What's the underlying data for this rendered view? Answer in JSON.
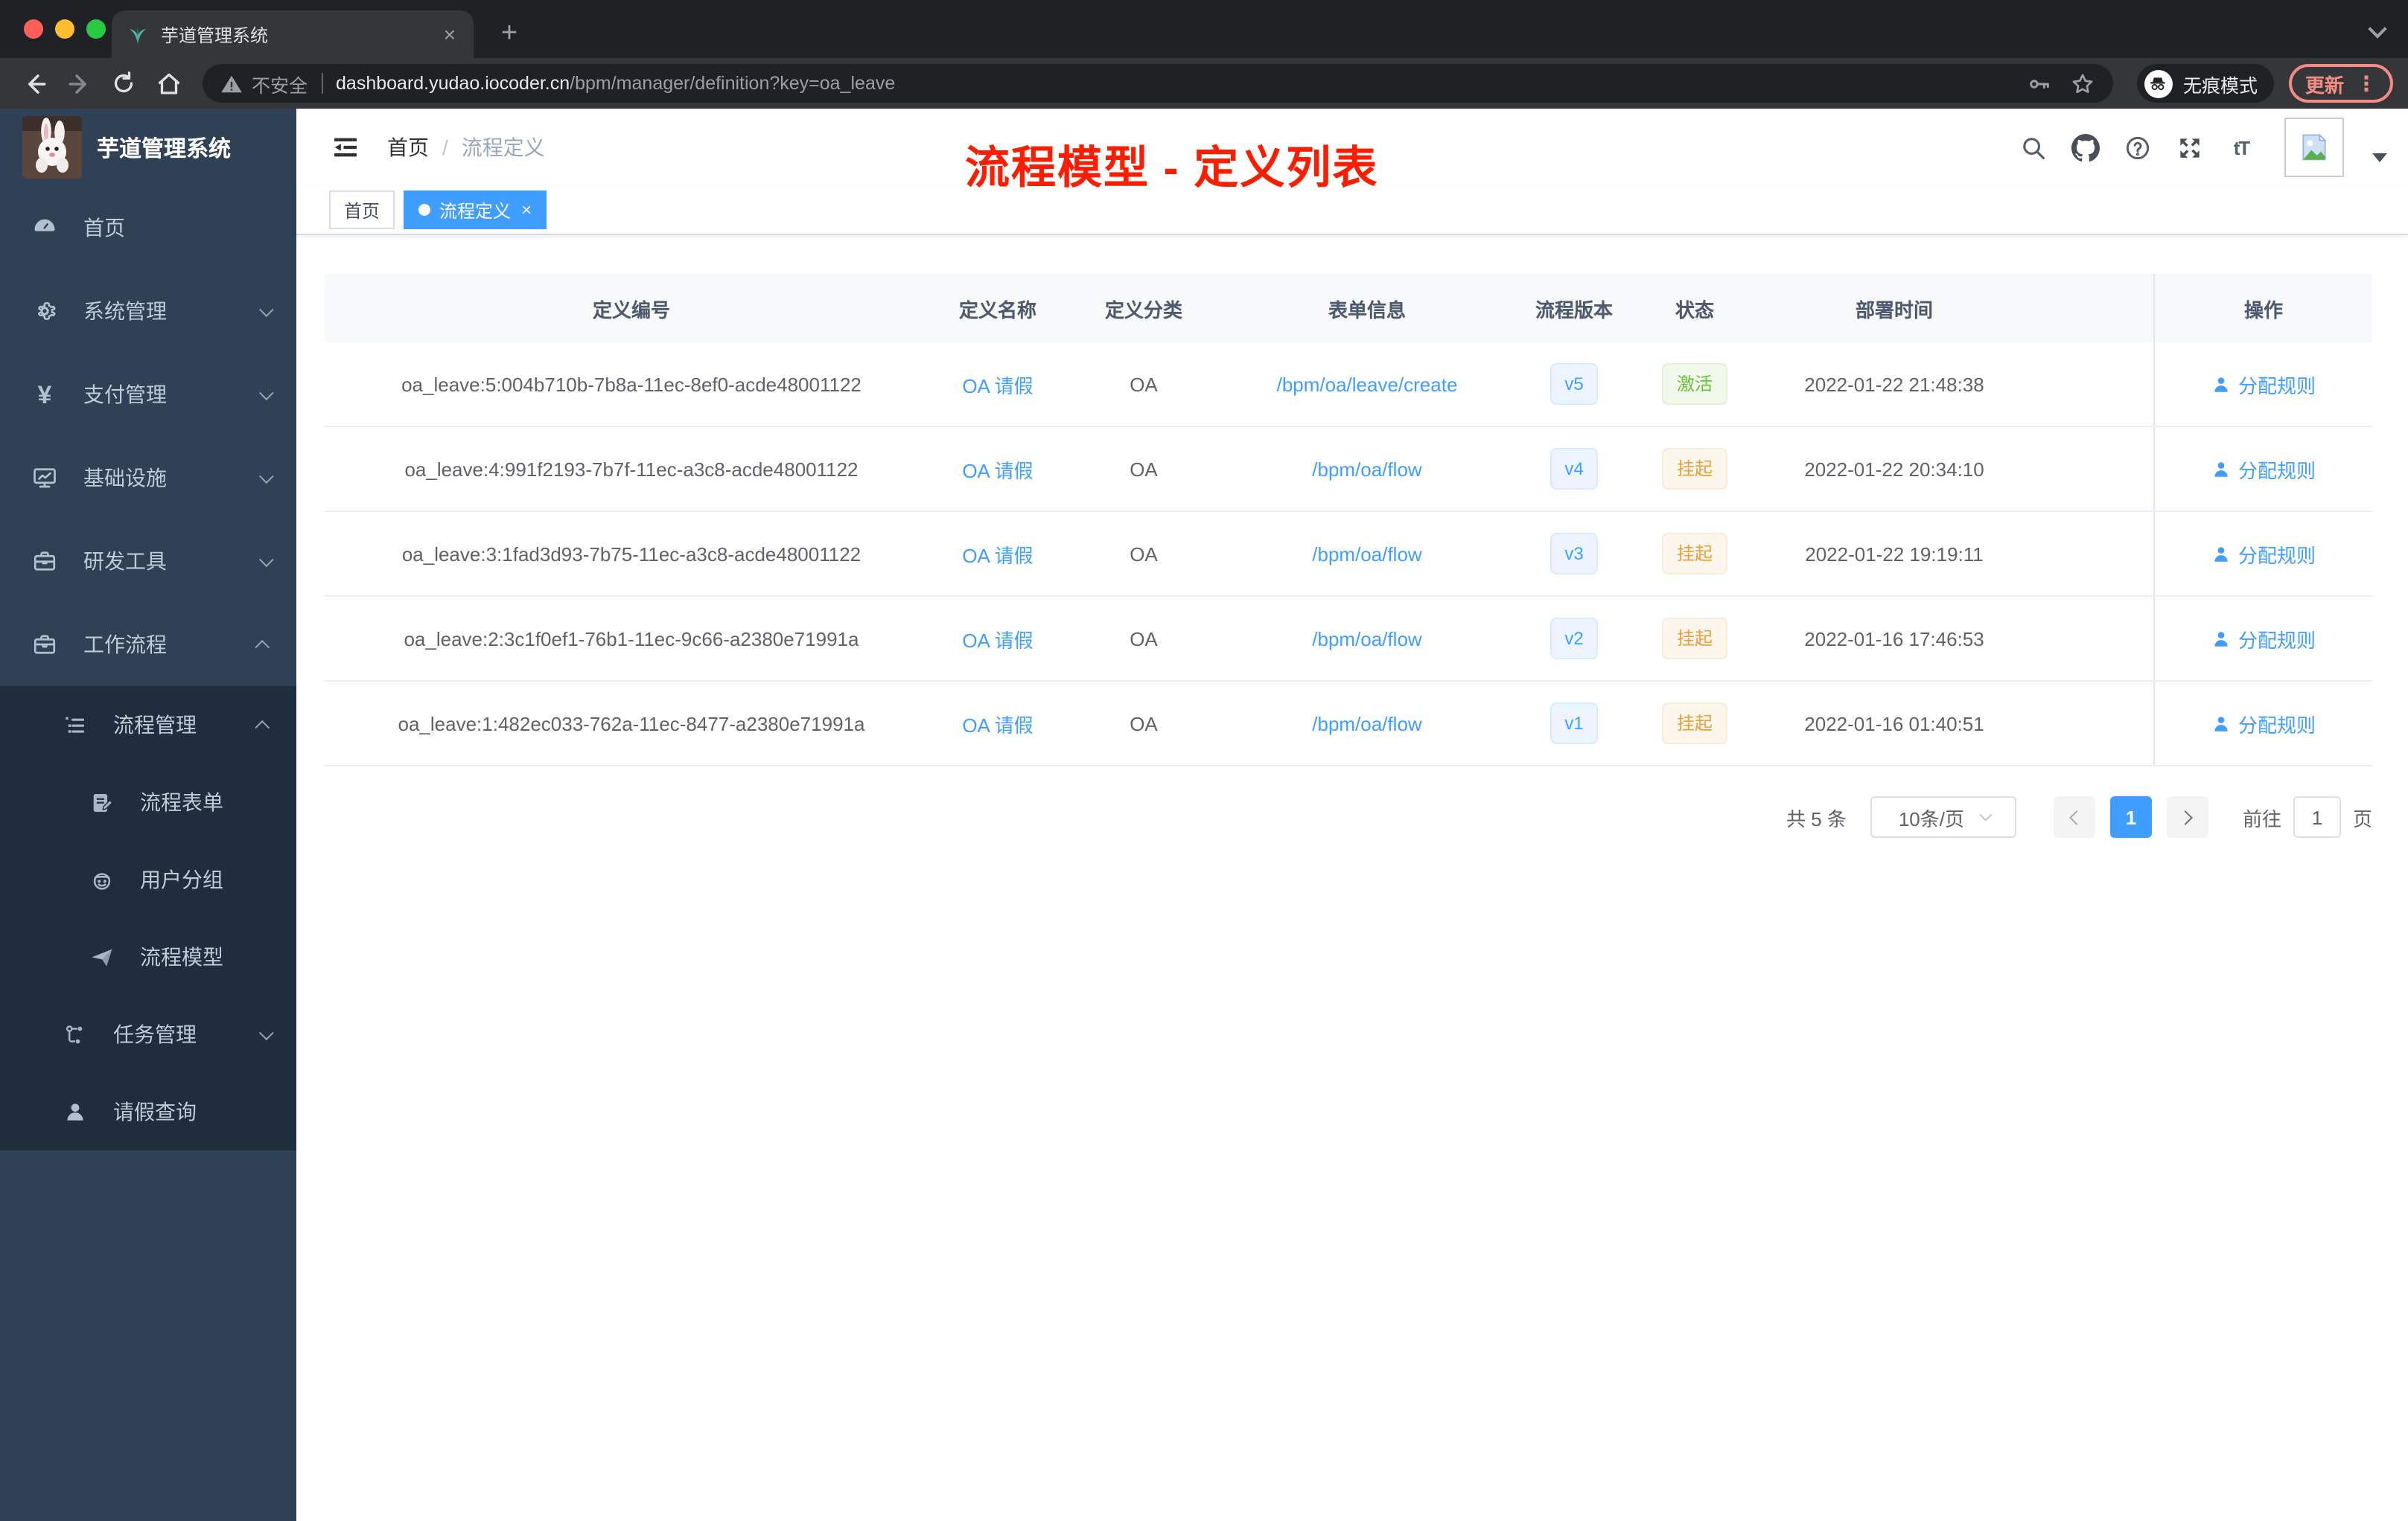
{
  "browser": {
    "tab_title": "芋道管理系统",
    "new_tab_label": "+",
    "tab_close_label": "×",
    "security_label": "不安全",
    "url_host": "dashboard.yudao.iocoder.cn",
    "url_path": "/bpm/manager/definition?key=oa_leave",
    "incognito_label": "无痕模式",
    "update_label": "更新",
    "menu_dots": "⋮"
  },
  "sidebar": {
    "logo_title": "芋道管理系统",
    "items": [
      {
        "label": "首页",
        "icon": "dashboard-icon"
      },
      {
        "label": "系统管理",
        "icon": "gear-icon"
      },
      {
        "label": "支付管理",
        "icon": "yen-icon"
      },
      {
        "label": "基础设施",
        "icon": "monitor-icon"
      },
      {
        "label": "研发工具",
        "icon": "toolbox-icon"
      },
      {
        "label": "工作流程",
        "icon": "briefcase-icon"
      }
    ],
    "submenu": [
      {
        "label": "流程管理",
        "icon": "list-icon"
      },
      {
        "label": "流程表单",
        "icon": "form-icon"
      },
      {
        "label": "用户分组",
        "icon": "user-group-icon"
      },
      {
        "label": "流程模型",
        "icon": "paper-plane-icon"
      },
      {
        "label": "任务管理",
        "icon": "tree-icon"
      },
      {
        "label": "请假查询",
        "icon": "person-icon"
      }
    ]
  },
  "header": {
    "breadcrumb_home": "首页",
    "breadcrumb_separator": "/",
    "breadcrumb_current": "流程定义",
    "annotation": "流程模型 - 定义列表"
  },
  "tags": [
    {
      "label": "首页",
      "active": false
    },
    {
      "label": "流程定义",
      "active": true,
      "close_label": "×"
    }
  ],
  "table": {
    "columns": [
      "定义编号",
      "定义名称",
      "定义分类",
      "表单信息",
      "流程版本",
      "状态",
      "部署时间",
      "操作"
    ],
    "rows": [
      {
        "id": "oa_leave:5:004b710b-7b8a-11ec-8ef0-acde48001122",
        "name": "OA 请假",
        "category": "OA",
        "form": "/bpm/oa/leave/create",
        "version": "v5",
        "status": "激活",
        "status_type": "success",
        "time": "2022-01-22 21:48:38",
        "action": "分配规则"
      },
      {
        "id": "oa_leave:4:991f2193-7b7f-11ec-a3c8-acde48001122",
        "name": "OA 请假",
        "category": "OA",
        "form": "/bpm/oa/flow",
        "version": "v4",
        "status": "挂起",
        "status_type": "warning",
        "time": "2022-01-22 20:34:10",
        "action": "分配规则"
      },
      {
        "id": "oa_leave:3:1fad3d93-7b75-11ec-a3c8-acde48001122",
        "name": "OA 请假",
        "category": "OA",
        "form": "/bpm/oa/flow",
        "version": "v3",
        "status": "挂起",
        "status_type": "warning",
        "time": "2022-01-22 19:19:11",
        "action": "分配规则"
      },
      {
        "id": "oa_leave:2:3c1f0ef1-76b1-11ec-9c66-a2380e71991a",
        "name": "OA 请假",
        "category": "OA",
        "form": "/bpm/oa/flow",
        "version": "v2",
        "status": "挂起",
        "status_type": "warning",
        "time": "2022-01-16 17:46:53",
        "action": "分配规则"
      },
      {
        "id": "oa_leave:1:482ec033-762a-11ec-8477-a2380e71991a",
        "name": "OA 请假",
        "category": "OA",
        "form": "/bpm/oa/flow",
        "version": "v1",
        "status": "挂起",
        "status_type": "warning",
        "time": "2022-01-16 01:40:51",
        "action": "分配规则"
      }
    ]
  },
  "pagination": {
    "total_label": "共 5 条",
    "page_size_label": "10条/页",
    "current_page": "1",
    "goto_label": "前往",
    "goto_value": "1",
    "page_unit_label": "页"
  },
  "icons": [
    "sprout-favicon",
    "back-icon",
    "forward-icon",
    "reload-icon",
    "home-icon",
    "warning-icon",
    "key-icon",
    "star-icon",
    "incognito-icon",
    "search-icon",
    "github-icon",
    "help-icon",
    "fullscreen-icon",
    "fontsize-icon",
    "avatar-placeholder-icon",
    "caret-down-icon",
    "hamburger-collapse-icon",
    "dashboard-icon",
    "gear-icon",
    "yen-icon",
    "monitor-icon",
    "toolbox-icon",
    "briefcase-icon",
    "list-icon",
    "form-icon",
    "user-group-icon",
    "paper-plane-icon",
    "tree-icon",
    "person-icon",
    "user-icon"
  ],
  "colors": {
    "accent": "#409eff",
    "success": "#67c23a",
    "warning": "#e6a23c",
    "annotation_red": "#fe1d00",
    "sidebar_bg": "#304156",
    "submenu_bg": "#1f2d3d",
    "update_red": "#f28b82",
    "chrome_dark": "#202124",
    "chrome_toolbar": "#35363a"
  }
}
